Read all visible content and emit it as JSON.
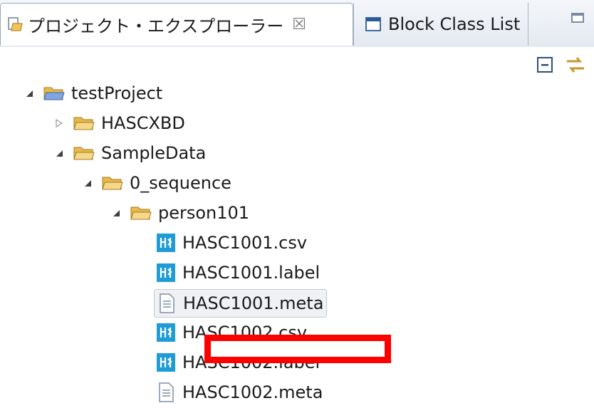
{
  "tabs": {
    "active": {
      "label": "プロジェクト・エクスプローラー",
      "close": "☒"
    },
    "inactive": {
      "label": "Block Class List"
    }
  },
  "toolbar": {
    "icons": [
      "collapse-all-icon",
      "link-with-editor-icon"
    ]
  },
  "tree": {
    "project": "testProject",
    "folders": {
      "hascxbd": "HASCXBD",
      "sampledata": "SampleData",
      "sequence": "0_sequence",
      "person": "person101"
    },
    "files": [
      "HASC1001.csv",
      "HASC1001.label",
      "HASC1001.meta",
      "HASC1002.csv",
      "HASC1002.label",
      "HASC1002.meta"
    ]
  },
  "colors": {
    "annotation_box": "#ff0000",
    "folder": "#e8b84a",
    "hasc_icon": "#1f9bd7"
  }
}
